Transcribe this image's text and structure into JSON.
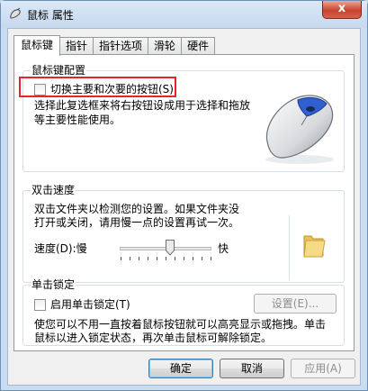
{
  "window": {
    "title": "鼠标 属性",
    "close_label": "x"
  },
  "tabs": [
    "鼠标键",
    "指针",
    "指针选项",
    "滑轮",
    "硬件"
  ],
  "button_config": {
    "group_label": "鼠标键配置",
    "switch_label": "切换主要和次要的按钮(S)",
    "desc_line1": "选择此复选框来将右按钮设成用于选择和拖放",
    "desc_line2": "等主要性能使用。"
  },
  "double_click": {
    "group_label": "双击速度",
    "desc_line1": "双击文件夹以检测您的设置。如果文件夹没",
    "desc_line2": "打开或关闭，请用慢一点的设置再试一次。",
    "speed_label": "速度(D):慢",
    "fast_label": "快",
    "speed_level": 0.55
  },
  "click_lock": {
    "group_label": "单击锁定",
    "enable_label": "启用单击锁定(T)",
    "settings_button": "设置(E)...",
    "desc_line1": "使您可以不用一直按着鼠标按钮就可以高亮显示或拖拽。单击",
    "desc_line2": "鼠标以进入锁定状态，再次单击鼠标可解除锁定。"
  },
  "footer": {
    "ok": "确定",
    "cancel": "取消",
    "apply": "应用(A)"
  }
}
